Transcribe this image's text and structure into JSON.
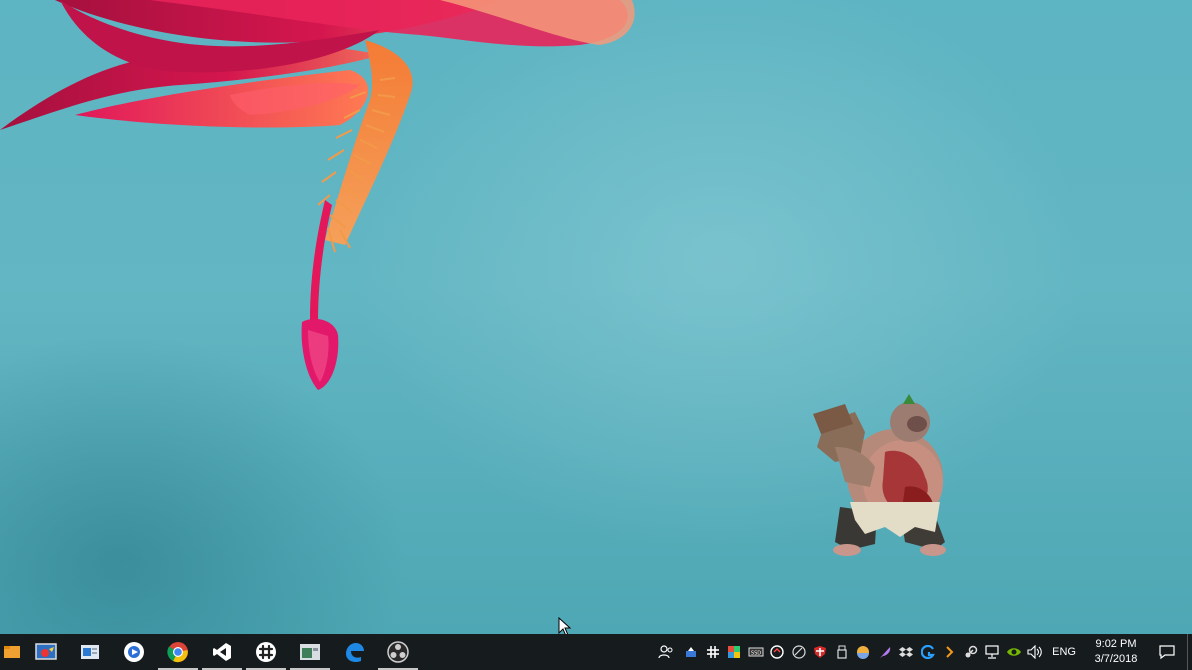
{
  "desktop": {
    "wallpaper": "flower-macro-wallpaper",
    "background_color": "#5db4c2",
    "shortcut_name": "pudge-icon"
  },
  "taskbar": {
    "background_color": "#161b1e",
    "pinned_apps": [
      {
        "name": "folder-app-icon",
        "running": false
      },
      {
        "name": "screen-capture-icon",
        "running": false
      },
      {
        "name": "file-explorer-icon",
        "running": false
      },
      {
        "name": "media-player-icon",
        "running": false
      },
      {
        "name": "chrome-icon",
        "running": true
      },
      {
        "name": "visual-studio-icon",
        "running": true
      },
      {
        "name": "slack-icon",
        "running": true
      },
      {
        "name": "terminal-window-icon",
        "running": true
      },
      {
        "name": "edge-icon",
        "running": false
      },
      {
        "name": "obs-icon",
        "running": true
      }
    ],
    "tray": {
      "icons": [
        "people-icon",
        "network-drive-icon",
        "slack-tray-icon",
        "office-icon",
        "ssd-icon",
        "sync-icon",
        "meeting-icon",
        "security-shield-icon",
        "usb-icon",
        "weather-icon",
        "feather-icon",
        "dropbox-icon",
        "logitech-icon",
        "chevron-icon",
        "steam-icon",
        "network-icon",
        "nvidia-icon",
        "volume-icon"
      ],
      "language": "ENG",
      "time": "9:02 PM",
      "date": "3/7/2018"
    }
  }
}
